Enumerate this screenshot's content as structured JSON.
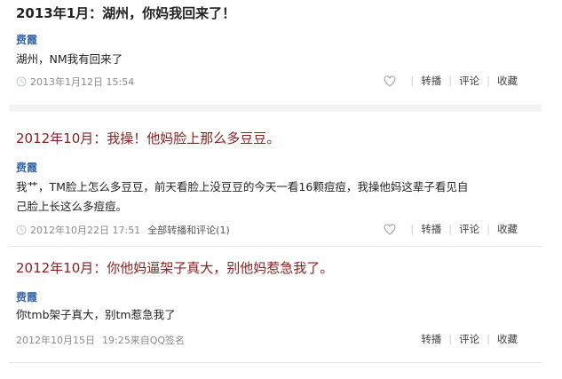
{
  "posts": [
    {
      "headline": "2013年1月：湖州，你妈我回来了！",
      "author": "费霞",
      "content": "湖州，NM我有回来了",
      "time": "2013年1月12日 15:54",
      "source": "",
      "has_like": true
    },
    {
      "headline": "2012年10月：我操！他妈脸上那么多豆豆。",
      "author": "费霞",
      "content_line1": "我艹，TM脸上怎么多豆豆，前天看脸上没豆豆的今天一看16颗痘痘，我操他妈这辈子看见自",
      "content_line2": "己脸上长这么多痘痘。",
      "time": "2012年10月22日 17:51",
      "source": "全部转播和评论(1)",
      "has_like": true
    },
    {
      "headline": "2012年10月：你他妈逼架子真大，别他妈惹急我了。",
      "author": "费霞",
      "content": "你tmb架子真大，别tm惹急我了",
      "time": "2012年10月15日",
      "source": "19:25来自QQ签名",
      "has_like": false
    }
  ],
  "actions": {
    "repost": "转播",
    "comment": "评论",
    "favorite": "收藏"
  },
  "colors": {
    "headline": "#8b1d1d",
    "author": "#3a6aa8",
    "meta": "#8a8a8a"
  }
}
